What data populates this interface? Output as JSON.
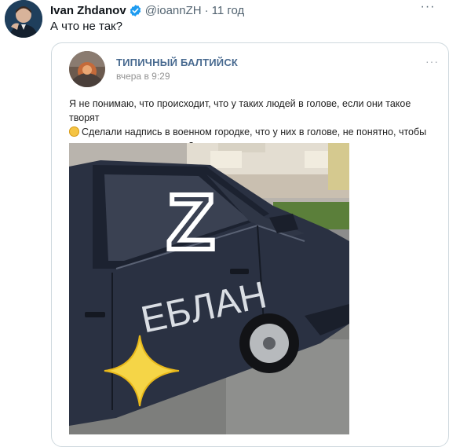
{
  "tweet": {
    "author_name": "Ivan Zhdanov",
    "handle": "@ioannZH",
    "separator": "·",
    "time": "11 год",
    "more_label": "···",
    "text": "А что не так?"
  },
  "vk_post": {
    "group_name": "ТИПИЧНЫЙ БАЛТИЙСК",
    "time": "вчера в 9:29",
    "more_label": "···",
    "text_line1": "Я не понимаю, что происходит, что у таких людей в голове, если они такое творят",
    "text_line2": "Сделали надпись в военном городке, что у них в голове, не понятно, чтобы",
    "text_line3": "портить чужое имущество?"
  },
  "photo": {
    "graffiti_letter": "Z",
    "graffiti_word": "ЕБЛАН"
  },
  "colors": {
    "vk_link": "#47698f",
    "verified": "#1d9bf0",
    "car_body": "#2a3142",
    "graffiti": "#ffffff"
  },
  "icons": {
    "verified": "verified-badge-icon",
    "more": "more-options-icon"
  }
}
